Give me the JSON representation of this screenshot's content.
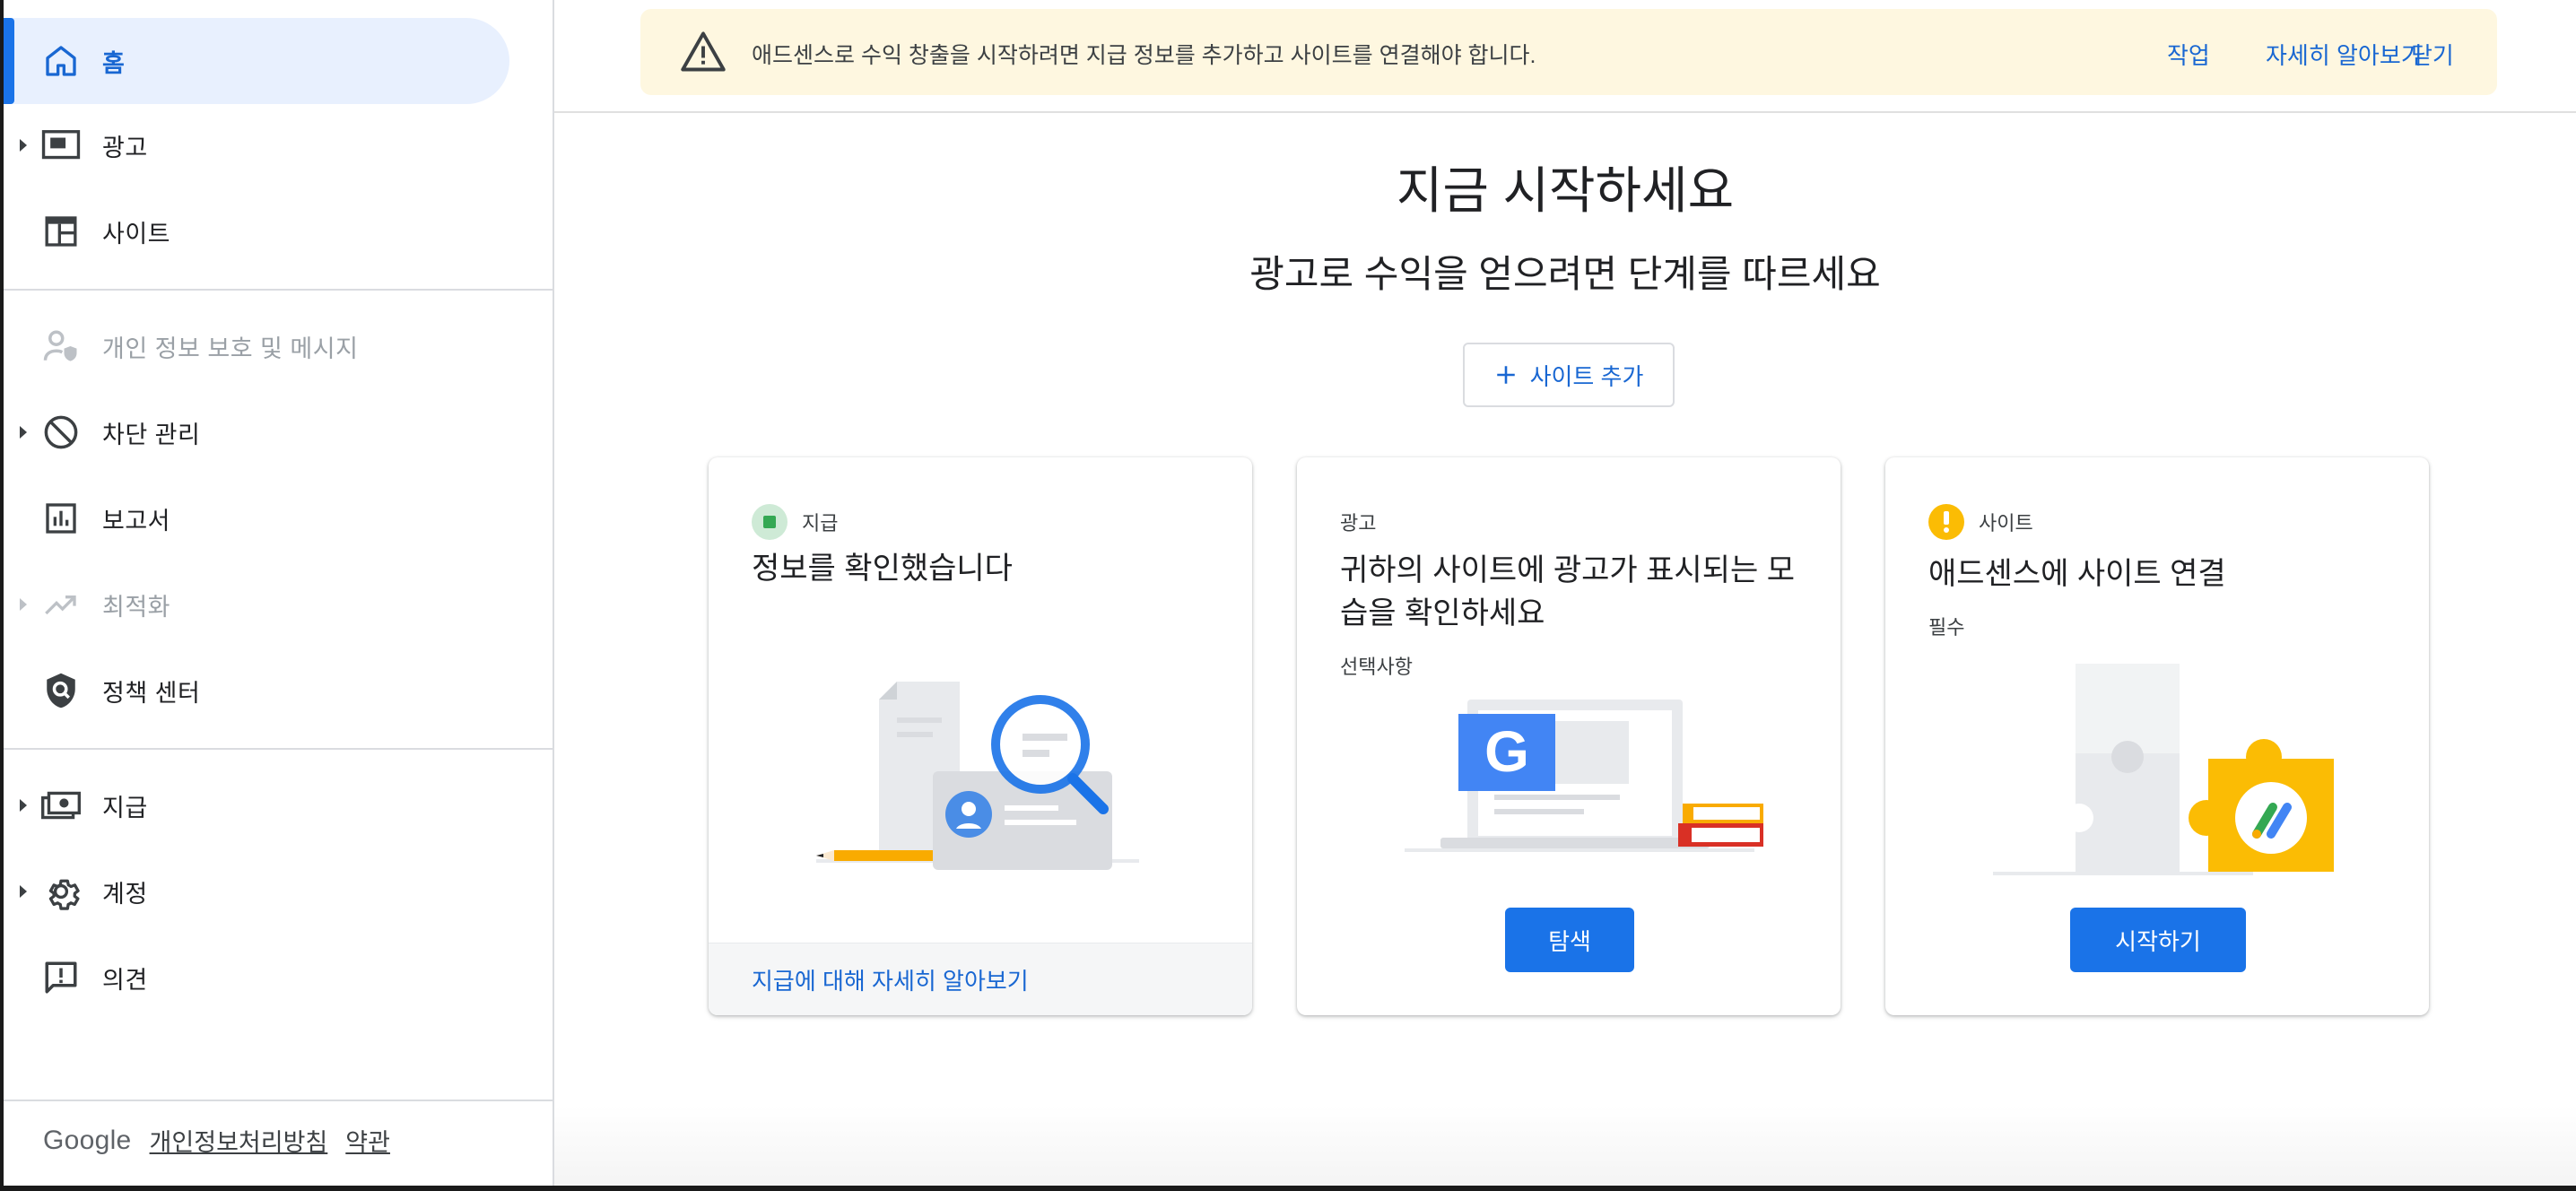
{
  "sidebar": {
    "items": [
      {
        "label": "홈",
        "icon": "home-icon",
        "active": true
      },
      {
        "label": "광고",
        "icon": "ads-icon"
      },
      {
        "label": "사이트",
        "icon": "sites-icon"
      },
      {
        "label": "개인 정보 보호 및 메시지",
        "icon": "privacy-icon",
        "disabled": true
      },
      {
        "label": "차단 관리",
        "icon": "block-icon"
      },
      {
        "label": "보고서",
        "icon": "reports-icon"
      },
      {
        "label": "최적화",
        "icon": "optimization-icon",
        "disabled": true
      },
      {
        "label": "정책 센터",
        "icon": "policy-shield-icon"
      },
      {
        "label": "지급",
        "icon": "payments-icon"
      },
      {
        "label": "계정",
        "icon": "gear-icon"
      },
      {
        "label": "의견",
        "icon": "feedback-icon"
      }
    ],
    "footer": {
      "brand": "Google",
      "privacy": "개인정보처리방침",
      "terms": "약관"
    }
  },
  "banner": {
    "icon": "warning-icon",
    "text": "애드센스로 수익 창출을 시작하려면 지급 정보를 추가하고 사이트를 연결해야 합니다.",
    "actions": [
      "작업",
      "자세히 알아보기",
      "닫기"
    ]
  },
  "hero": {
    "title": "지금 시작하세요",
    "subtitle": "광고로 수익을 얻으려면 단계를 따르세요",
    "add_site_label": "사이트 추가"
  },
  "cards": [
    {
      "tag": "지급",
      "title": "정보를 확인했습니다",
      "footer_link": "지급에 대해 자세히 알아보기"
    },
    {
      "tag": "광고",
      "title": "귀하의 사이트에 광고가 표시되는 모습을 확인하세요",
      "subtitle": "선택사항",
      "button": "탐색"
    },
    {
      "tag": "사이트",
      "title": "애드센스에 사이트 연결",
      "subtitle": "필수",
      "button": "시작하기"
    }
  ],
  "colors": {
    "accent": "#1a73e8",
    "link": "#1967d2",
    "banner_bg": "#fef7e0",
    "active_bg": "#e8f0fe",
    "success": "#34a853",
    "warning": "#fbbc04"
  }
}
